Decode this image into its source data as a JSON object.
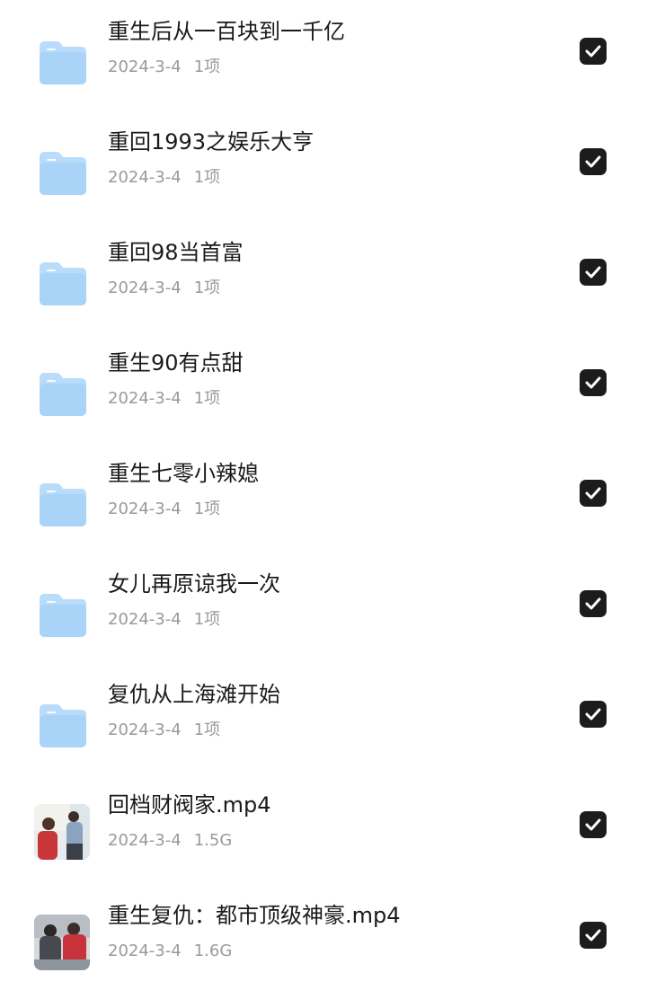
{
  "items": [
    {
      "type": "folder",
      "title": "重生后从一百块到一千亿",
      "date": "2024-3-4",
      "size": "1项",
      "checked": true,
      "icon": "folder-icon"
    },
    {
      "type": "folder",
      "title": "重回1993之娱乐大亨",
      "date": "2024-3-4",
      "size": "1项",
      "checked": true,
      "icon": "folder-icon"
    },
    {
      "type": "folder",
      "title": "重回98当首富",
      "date": "2024-3-4",
      "size": "1项",
      "checked": true,
      "icon": "folder-icon"
    },
    {
      "type": "folder",
      "title": "重生90有点甜",
      "date": "2024-3-4",
      "size": "1项",
      "checked": true,
      "icon": "folder-icon"
    },
    {
      "type": "folder",
      "title": "重生七零小辣媳",
      "date": "2024-3-4",
      "size": "1项",
      "checked": true,
      "icon": "folder-icon"
    },
    {
      "type": "folder",
      "title": "女儿再原谅我一次",
      "date": "2024-3-4",
      "size": "1项",
      "checked": true,
      "icon": "folder-icon"
    },
    {
      "type": "folder",
      "title": "复仇从上海滩开始",
      "date": "2024-3-4",
      "size": "1项",
      "checked": true,
      "icon": "folder-icon"
    },
    {
      "type": "video",
      "title": "回档财阀家.mp4",
      "date": "2024-3-4",
      "size": "1.5G",
      "checked": true,
      "icon": "video-thumbnail"
    },
    {
      "type": "video",
      "title": "重生复仇：都市顶级神豪.mp4",
      "date": "2024-3-4",
      "size": "1.6G",
      "checked": true,
      "icon": "video-thumbnail"
    }
  ],
  "colors": {
    "folder_top": "#cfe6fb",
    "folder_body": "#a9d3f7",
    "checkbox": "#1c1c1c",
    "title": "#1a1a1a",
    "meta": "#9a9a9a"
  }
}
